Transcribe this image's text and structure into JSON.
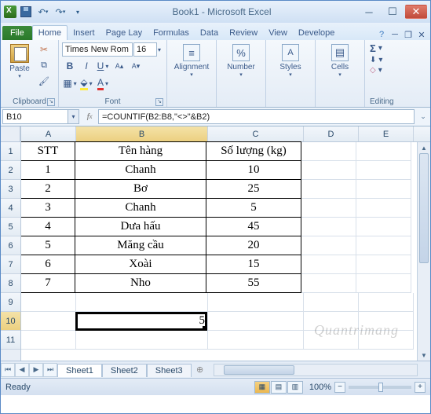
{
  "title": "Book1 - Microsoft Excel",
  "qat": {
    "save": "save",
    "undo": "undo",
    "redo": "redo"
  },
  "tabs": {
    "file": "File",
    "items": [
      "Home",
      "Insert",
      "Page Lay",
      "Formulas",
      "Data",
      "Review",
      "View",
      "Develope"
    ],
    "active": "Home"
  },
  "ribbon": {
    "clipboard": {
      "label": "Clipboard",
      "paste": "Paste"
    },
    "font": {
      "label": "Font",
      "name": "Times New Rom",
      "size": "16"
    },
    "alignment": {
      "label": "Alignment"
    },
    "number": {
      "label": "Number"
    },
    "styles": {
      "label": "Styles"
    },
    "cells": {
      "label": "Cells"
    },
    "editing": {
      "label": "Editing"
    }
  },
  "namebox": "B10",
  "formula": "=COUNTIF(B2:B8,\"<>\"&B2)",
  "columns": [
    "A",
    "B",
    "C",
    "D",
    "E"
  ],
  "rows": [
    "1",
    "2",
    "3",
    "4",
    "5",
    "6",
    "7",
    "8",
    "9",
    "10",
    "11"
  ],
  "headers": {
    "A": "STT",
    "B": "Tên hàng",
    "C": "Số lượng (kg)"
  },
  "data": [
    {
      "stt": "1",
      "ten": "Chanh",
      "sl": "10"
    },
    {
      "stt": "2",
      "ten": "Bơ",
      "sl": "25"
    },
    {
      "stt": "3",
      "ten": "Chanh",
      "sl": "5"
    },
    {
      "stt": "4",
      "ten": "Dưa hấu",
      "sl": "45"
    },
    {
      "stt": "5",
      "ten": "Măng cầu",
      "sl": "20"
    },
    {
      "stt": "6",
      "ten": "Xoài",
      "sl": "15"
    },
    {
      "stt": "7",
      "ten": "Nho",
      "sl": "55"
    }
  ],
  "result_cell": "5",
  "active": {
    "col": "B",
    "row": "10"
  },
  "sheets": {
    "items": [
      "Sheet1",
      "Sheet2",
      "Sheet3"
    ],
    "active": "Sheet1"
  },
  "status": {
    "ready": "Ready",
    "zoom": "100%"
  },
  "watermark": "Quantrimang"
}
